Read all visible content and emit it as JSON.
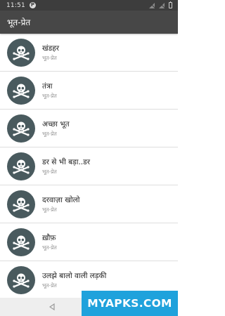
{
  "status_bar": {
    "time": "11:51",
    "notification_icon": "p-badge-icon",
    "icons": [
      "no-signal-icon",
      "no-signal-icon",
      "battery-icon"
    ]
  },
  "toolbar": {
    "title": "भूत-प्रेत"
  },
  "list": {
    "items": [
      {
        "title": "खंडहर",
        "subtitle": "भूत-प्रेत",
        "icon": "skull-crossbones-icon"
      },
      {
        "title": "तंत्रा",
        "subtitle": "भूत-प्रेत",
        "icon": "skull-crossbones-icon"
      },
      {
        "title": "अच्छा भूत",
        "subtitle": "भूत-प्रेत",
        "icon": "skull-crossbones-icon"
      },
      {
        "title": "डर से भी बड़ा..डर",
        "subtitle": "भूत-प्रेत",
        "icon": "skull-crossbones-icon"
      },
      {
        "title": "दरवाज़ा खोलो",
        "subtitle": "भूत-प्रेत",
        "icon": "skull-crossbones-icon"
      },
      {
        "title": "ख़ौफ़",
        "subtitle": "भूत-प्रेत",
        "icon": "skull-crossbones-icon"
      },
      {
        "title": "उलझे बालो वाली लड़की",
        "subtitle": "भूत-प्रेत",
        "icon": "skull-crossbones-icon"
      }
    ]
  },
  "nav_bar": {
    "back_icon": "back-triangle-icon"
  },
  "watermark": {
    "text": "MYAPKS.COM"
  },
  "colors": {
    "status_bar": "#3d3d3d",
    "toolbar": "#474747",
    "avatar": "#495a5e",
    "watermark": "#1fa2dc"
  }
}
